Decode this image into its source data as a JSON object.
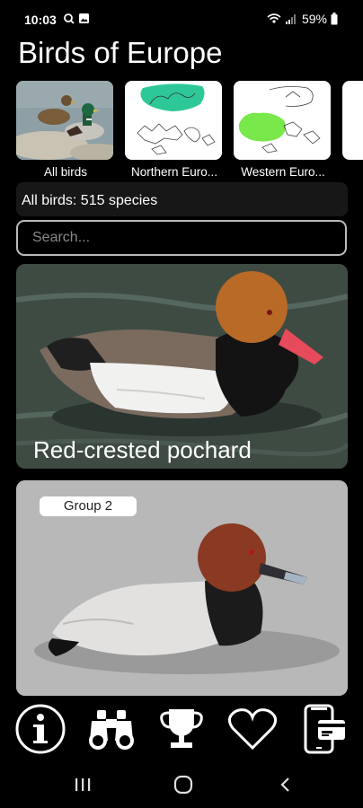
{
  "status_bar": {
    "time": "10:03",
    "battery": "59%"
  },
  "app": {
    "title": "Birds of Europe"
  },
  "categories": [
    {
      "label": "All birds"
    },
    {
      "label": "Northern Euro..."
    },
    {
      "label": "Western Euro..."
    }
  ],
  "summary": {
    "count_text": "All birds: 515 species"
  },
  "search": {
    "placeholder": "Search..."
  },
  "cards": [
    {
      "name": "Red-crested pochard"
    },
    {
      "group": "Group 2"
    }
  ],
  "colors": {
    "map_highlight": "#2ec898",
    "map_highlight_west": "#78e84a",
    "background": "#000000"
  },
  "bottom_nav_icons": [
    "info-icon",
    "binoculars-icon",
    "trophy-icon",
    "heart-icon",
    "phone-card-icon"
  ]
}
